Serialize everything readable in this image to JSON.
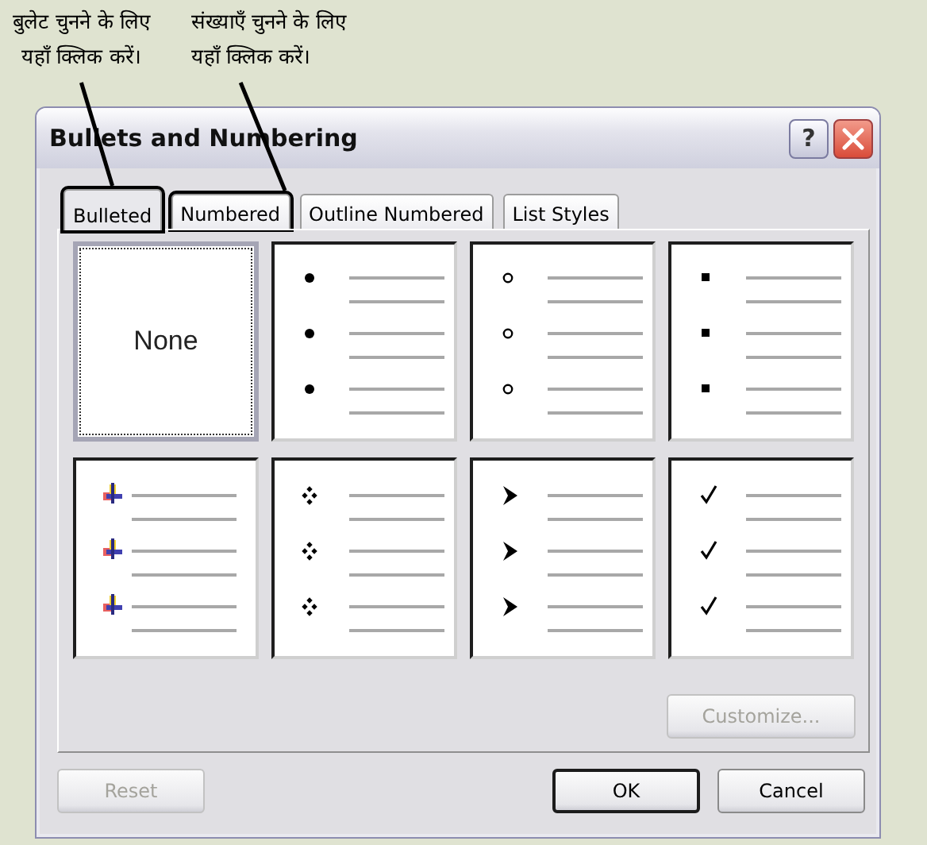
{
  "notes": [
    {
      "text": "बुलेट चुनने के लिए\nयहाँ क्लिक करें।"
    },
    {
      "text": "संख्याएँ चुनने के लिए\nयहाँ क्लिक करें।"
    }
  ],
  "window": {
    "title": "Bullets and Numbering",
    "help": "?"
  },
  "tabs": [
    {
      "label": "Bulleted",
      "selected": true,
      "highlighted": true
    },
    {
      "label": "Numbered",
      "selected": false,
      "highlighted": true
    },
    {
      "label": "Outline Numbered",
      "selected": false,
      "highlighted": false
    },
    {
      "label": "List Styles",
      "selected": false,
      "highlighted": false
    }
  ],
  "gallery": [
    {
      "kind": "none",
      "label": "None",
      "selected": true
    },
    {
      "kind": "disc",
      "selected": false
    },
    {
      "kind": "circle",
      "selected": false
    },
    {
      "kind": "square",
      "selected": false
    },
    {
      "kind": "picture",
      "selected": false
    },
    {
      "kind": "diamonds",
      "selected": false
    },
    {
      "kind": "arrowhead",
      "selected": false
    },
    {
      "kind": "check",
      "selected": false
    }
  ],
  "customize_button": {
    "label": "Customize...",
    "disabled": true
  },
  "buttons": [
    {
      "label": "Reset",
      "disabled": true,
      "default": false
    },
    {
      "label": "OK",
      "disabled": false,
      "default": true
    },
    {
      "label": "Cancel",
      "disabled": false,
      "default": false
    }
  ]
}
